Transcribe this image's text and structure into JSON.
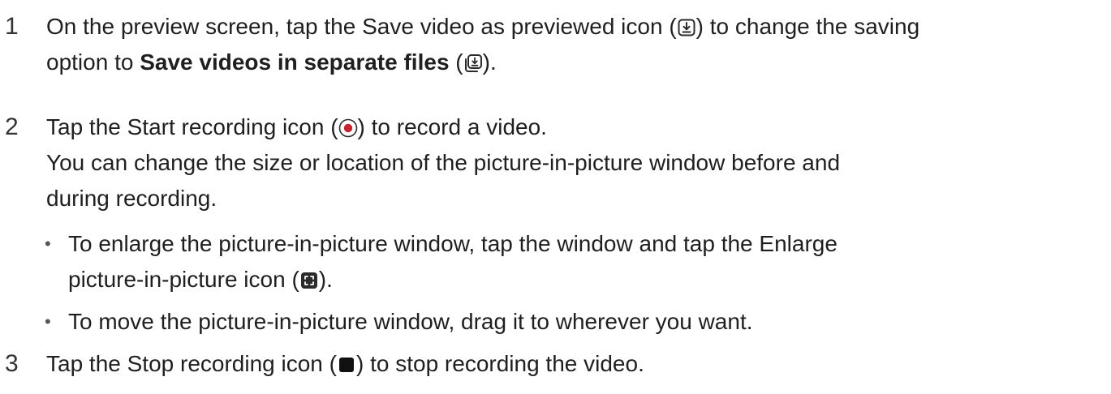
{
  "steps": [
    {
      "number": "1",
      "line1_before_icon": "On the preview screen, tap the Save video as previewed icon (",
      "line1_after_icon": ") to change the saving",
      "save_previewed_icon": "save-as-previewed-icon",
      "line2_before_bold": "option to ",
      "bold": "Save videos in separate files",
      "line2_mid": " (",
      "separate_files_icon": "save-separate-files-icon",
      "line2_end": ")."
    },
    {
      "number": "2",
      "line1_before_icon": "Tap the Start recording icon (",
      "record_icon": "start-recording-icon",
      "line1_after_icon": ") to record a video.",
      "note_line1": "You can change the size or location of the picture-in-picture window before and",
      "note_line2": "during recording.",
      "bullets": [
        {
          "line1": "To enlarge the picture-in-picture window, tap the window and tap the Enlarge",
          "line2_before_icon": "picture-in-picture icon (",
          "enlarge_icon": "enlarge-pip-icon",
          "line2_after_icon": ")."
        },
        {
          "line1": "To move the picture-in-picture window, drag it to wherever you want."
        }
      ]
    },
    {
      "number": "3",
      "line1_before_icon": "Tap the Stop recording icon (",
      "stop_icon": "stop-recording-icon",
      "line1_after_icon": ") to stop recording the video."
    }
  ],
  "colors": {
    "text": "#1f1f1f",
    "record_red": "#c8242f",
    "icon_dark": "#2b2b2b"
  }
}
